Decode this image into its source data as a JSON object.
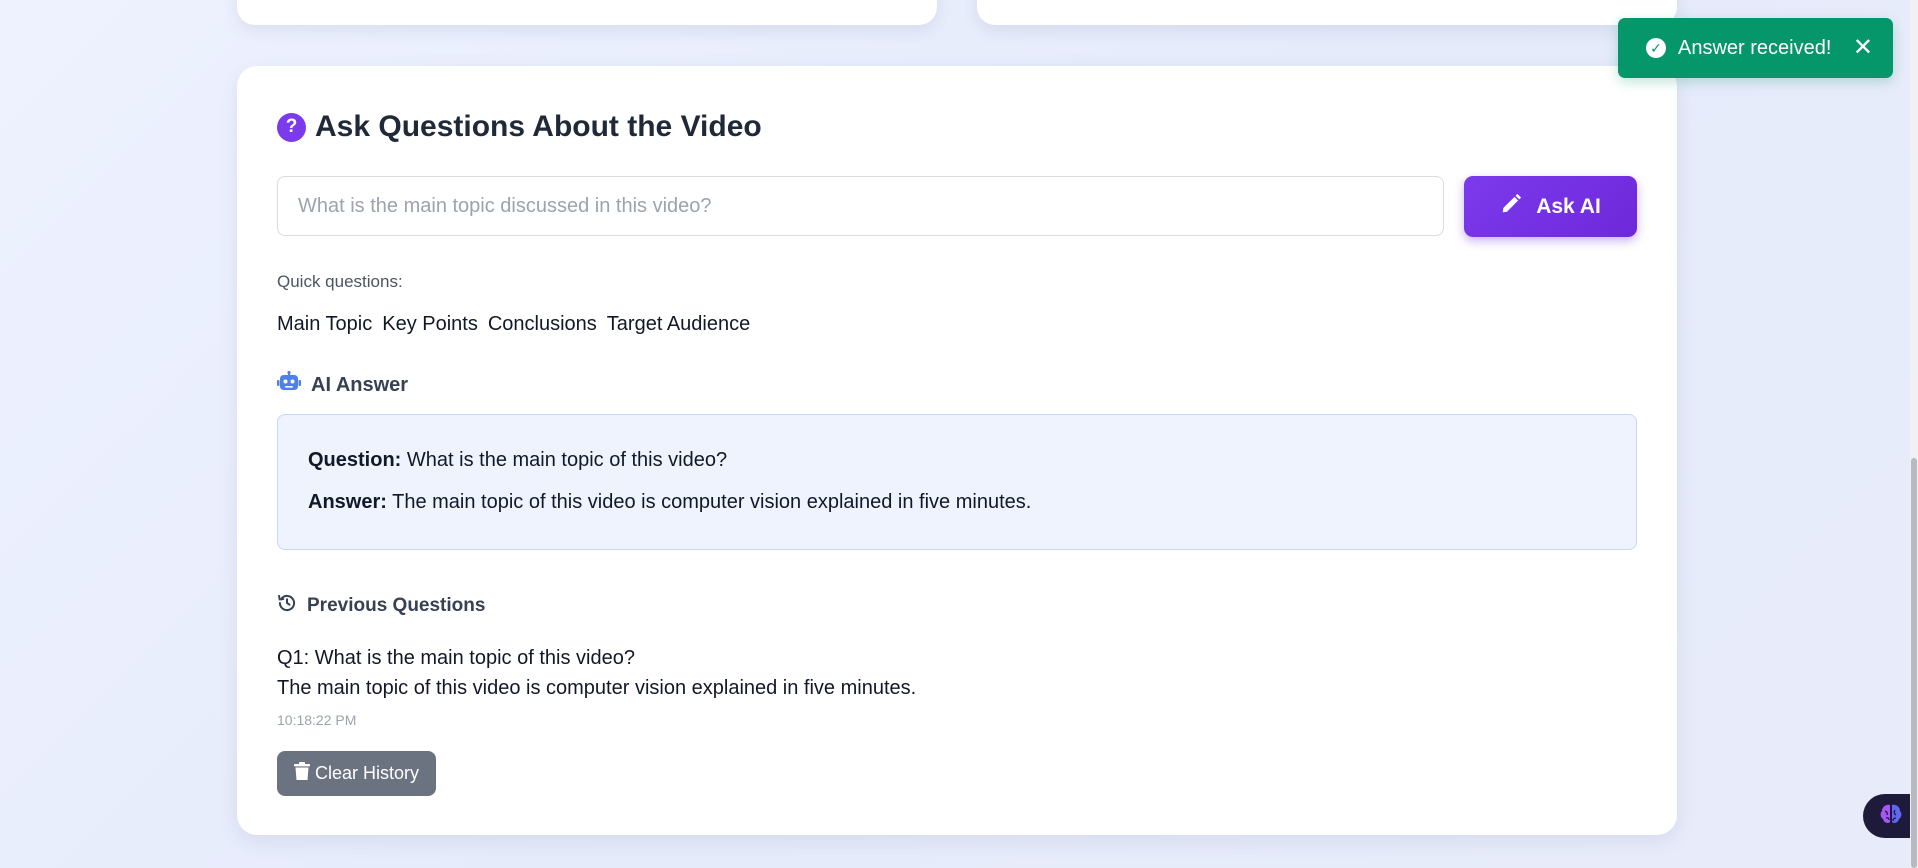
{
  "section": {
    "title": "Ask Questions About the Video",
    "question_icon_glyph": "?"
  },
  "input": {
    "placeholder": "What is the main topic discussed in this video?",
    "value": ""
  },
  "ask_button": {
    "label": "Ask AI",
    "icon": "pencil-icon"
  },
  "quick_questions": {
    "label": "Quick questions:",
    "items": [
      "Main Topic",
      "Key Points",
      "Conclusions",
      "Target Audience"
    ]
  },
  "ai_answer": {
    "heading": "AI Answer",
    "icon": "robot-icon",
    "question_label": "Question:",
    "question_text": "What is the main topic of this video?",
    "answer_label": "Answer:",
    "answer_text": "The main topic of this video is computer vision explained in five minutes."
  },
  "previous_questions": {
    "heading": "Previous Questions",
    "icon": "history-icon",
    "items": [
      {
        "question": "Q1: What is the main topic of this video?",
        "answer": "The main topic of this video is computer vision explained in five minutes.",
        "time": "10:18:22 PM"
      }
    ]
  },
  "clear_button": {
    "label": "Clear History",
    "icon": "trash-icon"
  },
  "toast": {
    "message": "Answer received!",
    "icon": "check-circle-icon",
    "close_glyph": "✕"
  },
  "colors": {
    "accent": "#7c3aed",
    "toast": "#059669",
    "answer_bg": "#eef3fe",
    "clear_button": "#6b7280"
  }
}
